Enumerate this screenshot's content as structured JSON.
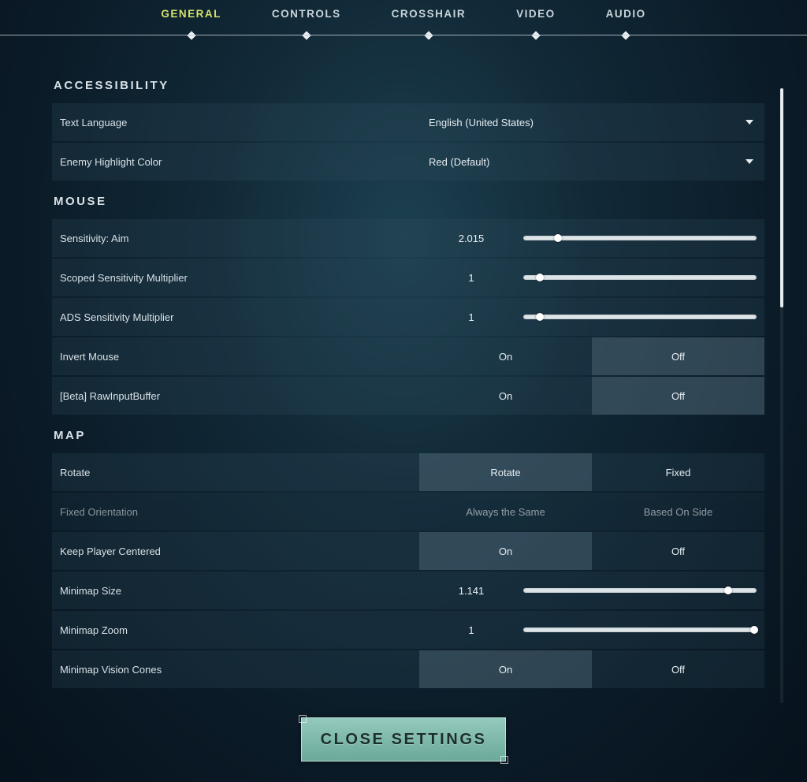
{
  "tabs": [
    "GENERAL",
    "CONTROLS",
    "CROSSHAIR",
    "VIDEO",
    "AUDIO"
  ],
  "active_tab": 0,
  "close_label": "CLOSE SETTINGS",
  "sections": {
    "accessibility": {
      "title": "ACCESSIBILITY",
      "text_language": {
        "label": "Text Language",
        "value": "English (United States)"
      },
      "enemy_highlight": {
        "label": "Enemy Highlight Color",
        "value": "Red (Default)"
      }
    },
    "mouse": {
      "title": "MOUSE",
      "sens_aim": {
        "label": "Sensitivity: Aim",
        "value": "2.015",
        "knob_pct": 15
      },
      "scoped_mult": {
        "label": "Scoped Sensitivity Multiplier",
        "value": "1",
        "knob_pct": 7
      },
      "ads_mult": {
        "label": "ADS Sensitivity Multiplier",
        "value": "1",
        "knob_pct": 7
      },
      "invert": {
        "label": "Invert Mouse",
        "options": [
          "On",
          "Off"
        ],
        "selected": 1
      },
      "raw_input": {
        "label": "[Beta] RawInputBuffer",
        "options": [
          "On",
          "Off"
        ],
        "selected": 1
      }
    },
    "map": {
      "title": "MAP",
      "rotate": {
        "label": "Rotate",
        "options": [
          "Rotate",
          "Fixed"
        ],
        "selected": 0
      },
      "fixed_orient": {
        "label": "Fixed Orientation",
        "options": [
          "Always the Same",
          "Based On Side"
        ],
        "selected": -1,
        "disabled": true
      },
      "keep_centered": {
        "label": "Keep Player Centered",
        "options": [
          "On",
          "Off"
        ],
        "selected": 0
      },
      "minimap_size": {
        "label": "Minimap Size",
        "value": "1.141",
        "knob_pct": 88
      },
      "minimap_zoom": {
        "label": "Minimap Zoom",
        "value": "1",
        "knob_pct": 99
      },
      "vision_cones": {
        "label": "Minimap Vision Cones",
        "options": [
          "On",
          "Off"
        ],
        "selected": 0
      }
    }
  }
}
